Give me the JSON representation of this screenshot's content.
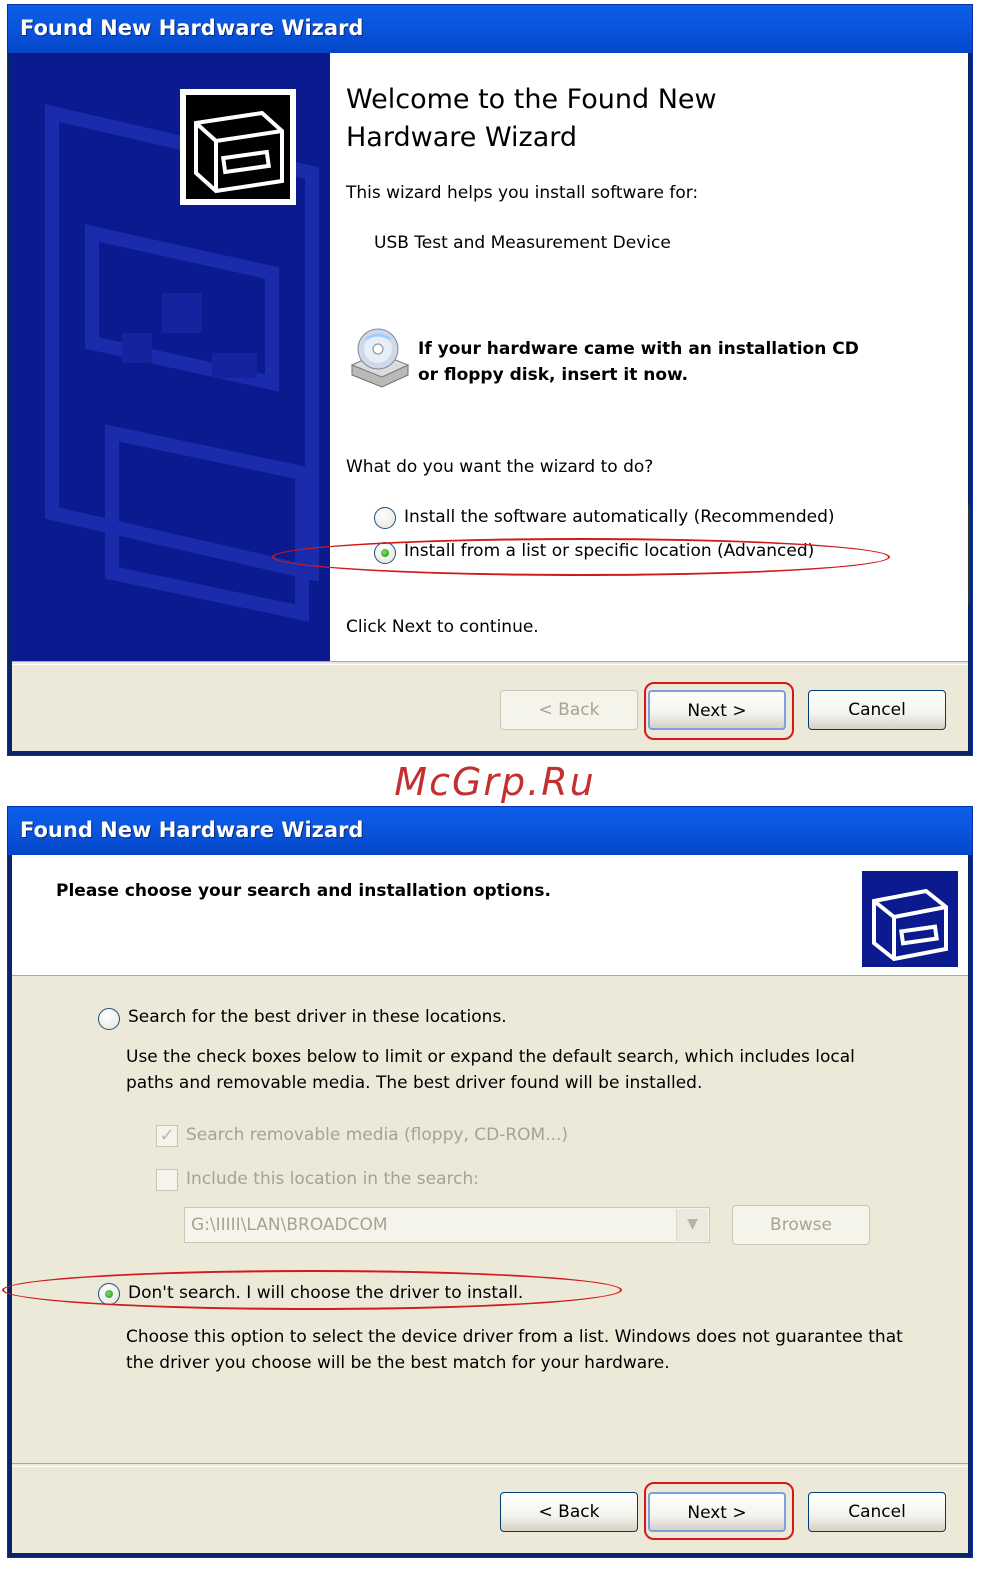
{
  "window1": {
    "title": "Found New Hardware Wizard",
    "welcome_title": "Welcome to the Found New Hardware Wizard",
    "intro": "This wizard helps you install software for:",
    "device_name": "USB Test and Measurement Device",
    "cd_prompt_line1": "If your hardware came with an installation CD",
    "cd_prompt_line2": "or floppy disk, insert it now.",
    "question": "What do you want the wizard to do?",
    "options": [
      {
        "label": "Install the software automatically (Recommended)",
        "selected": false
      },
      {
        "label": "Install from a list or specific location (Advanced)",
        "selected": true
      }
    ],
    "continue_hint": "Click Next to continue.",
    "buttons": {
      "back": "< Back",
      "next": "Next >",
      "cancel": "Cancel"
    },
    "back_enabled": false
  },
  "watermark": "McGrp.Ru",
  "window2": {
    "title": "Found New Hardware Wizard",
    "header": "Please choose your search and installation options.",
    "option_search": {
      "label": "Search for the best driver in these locations.",
      "selected": false
    },
    "search_desc_line1": "Use the check boxes below to limit or expand the default search, which includes local",
    "search_desc_line2": "paths and removable media. The best driver found will be installed.",
    "check_removable": {
      "label": "Search removable media (floppy, CD-ROM...)",
      "checked": true,
      "enabled": false
    },
    "check_location": {
      "label": "Include this location in the search:",
      "checked": false,
      "enabled": false
    },
    "location_path": "G:\\IIIII\\LAN\\BROADCOM",
    "browse_label": "Browse",
    "option_dont_search": {
      "label": "Don't search. I will choose the driver to install.",
      "selected": true
    },
    "dont_search_desc_line1": "Choose this option to select the device driver from a list.  Windows does not guarantee that",
    "dont_search_desc_line2": "the driver you choose will be the best match for your hardware.",
    "buttons": {
      "back": "< Back",
      "next": "Next >",
      "cancel": "Cancel"
    }
  },
  "colors": {
    "title_bar": "#0b56df",
    "banner": "#0b1a8e",
    "dialog_bg": "#ece9d8",
    "annotation": "#d11a1a"
  },
  "icons": [
    "hardware-wizard-icon",
    "cd-drive-icon"
  ]
}
